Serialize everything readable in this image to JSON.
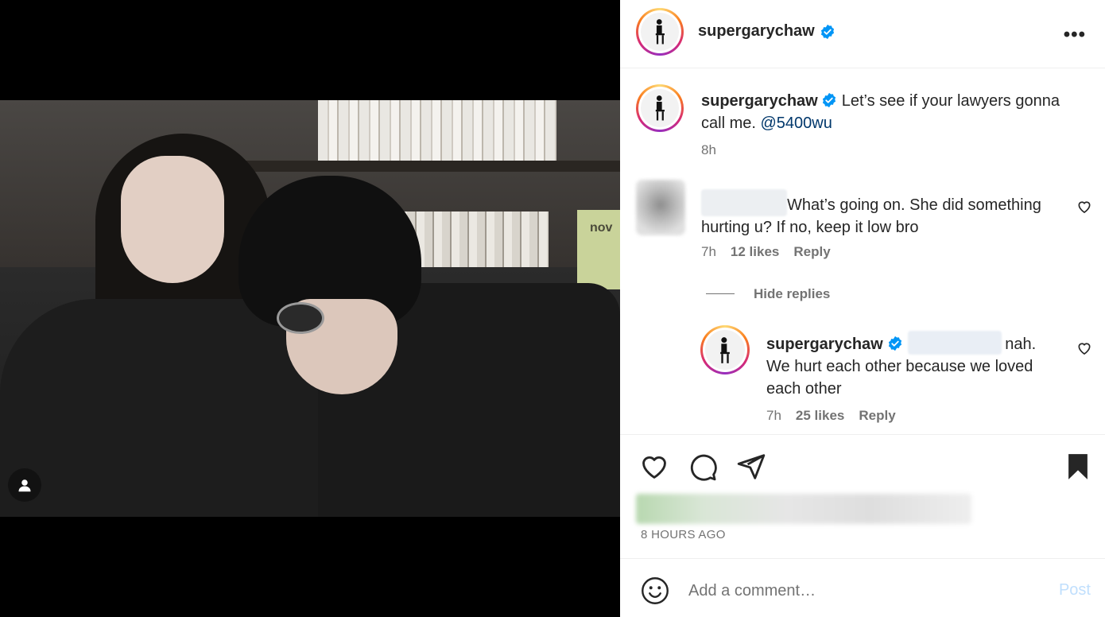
{
  "media": {
    "shelf_book_text": "nov",
    "user_tag_icon": "person-icon"
  },
  "post": {
    "author": "supergarychaw",
    "more_icon": "more-options-icon",
    "more_label": "•••",
    "caption": {
      "username": "supergarychaw",
      "text": "Let’s see if your lawyers gonna call me.",
      "mention": "@5400wu",
      "time": "8h"
    },
    "comments": [
      {
        "text": "What’s going on. She did something hurting u? If no, keep it low bro",
        "time": "7h",
        "likes": "12 likes",
        "reply_label": "Reply",
        "hide_replies_label": "Hide replies",
        "replies": [
          {
            "username": "supergarychaw",
            "text_start": "nah.",
            "text_rest": "We hurt each other because we loved each other",
            "time": "7h",
            "likes": "25 likes",
            "reply_label": "Reply"
          }
        ]
      }
    ],
    "actions": {
      "like_icon": "heart-icon",
      "comment_icon": "comment-icon",
      "share_icon": "send-icon",
      "save_icon": "bookmark-filled-icon"
    },
    "date": "8 HOURS AGO",
    "add_comment": {
      "placeholder": "Add a comment…",
      "post_label": "Post",
      "emoji_icon": "smile-icon"
    }
  },
  "colors": {
    "verified": "#0095f6",
    "mention": "#00376b",
    "muted": "#737373",
    "post_disabled": "#c0dffd"
  }
}
